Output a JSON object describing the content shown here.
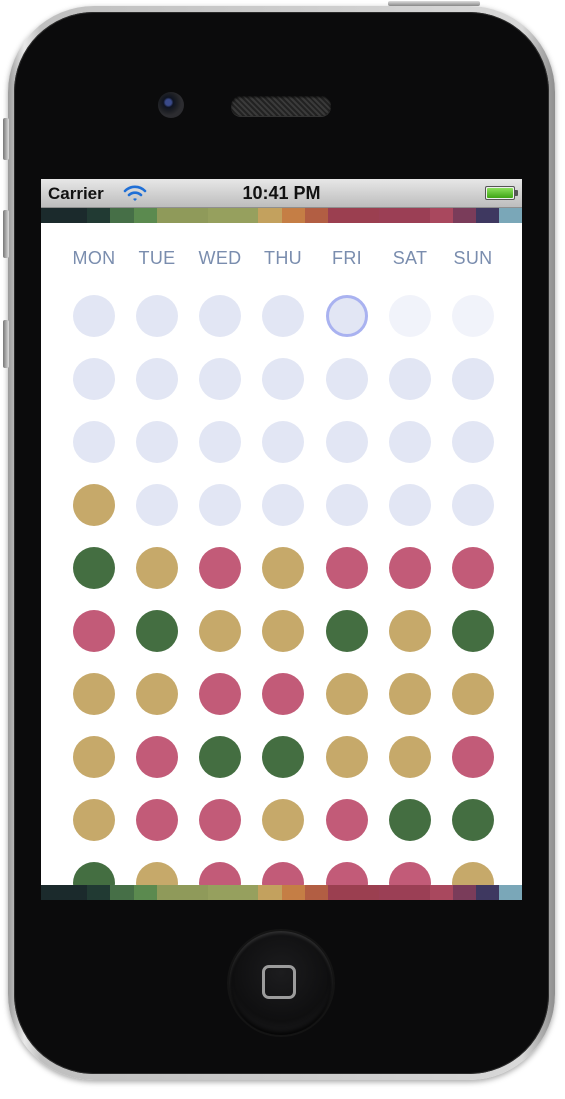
{
  "status_bar": {
    "carrier": "Carrier",
    "time": "10:41 PM",
    "battery_level": 1.0
  },
  "colors": {
    "empty": "#e2e6f4",
    "empty_future": "#f1f3fa",
    "gold": "#c6a96a",
    "green": "#446e41",
    "pink": "#c25b78",
    "today_ring": "#a9b2f0",
    "header_text": "#7a8dae"
  },
  "palette_strip": [
    "#1b2a2c",
    "#1b2a2c",
    "#213a33",
    "#466f47",
    "#5b8a4f",
    "#8f9a5a",
    "#96a05e",
    "#c3a15e",
    "#c57e45",
    "#b25e43",
    "#9b3f50",
    "#9b3f55",
    "#a9485e",
    "#7a3c5a",
    "#3e3860",
    "#7aa7b8"
  ],
  "days": [
    "MON",
    "TUE",
    "WED",
    "THU",
    "FRI",
    "SAT",
    "SUN"
  ],
  "today_index": 4,
  "grid": [
    [
      "empty",
      "empty",
      "empty",
      "empty",
      "today",
      "future",
      "future"
    ],
    [
      "empty",
      "empty",
      "empty",
      "empty",
      "empty",
      "empty",
      "empty"
    ],
    [
      "empty",
      "empty",
      "empty",
      "empty",
      "empty",
      "empty",
      "empty"
    ],
    [
      "gold",
      "empty",
      "empty",
      "empty",
      "empty",
      "empty",
      "empty"
    ],
    [
      "green",
      "gold",
      "pink",
      "gold",
      "pink",
      "pink",
      "pink"
    ],
    [
      "pink",
      "green",
      "gold",
      "gold",
      "green",
      "gold",
      "green"
    ],
    [
      "gold",
      "gold",
      "pink",
      "pink",
      "gold",
      "gold",
      "gold"
    ],
    [
      "gold",
      "pink",
      "green",
      "green",
      "gold",
      "gold",
      "pink"
    ],
    [
      "gold",
      "pink",
      "pink",
      "gold",
      "pink",
      "green",
      "green"
    ],
    [
      "green",
      "gold",
      "pink",
      "pink",
      "pink",
      "pink",
      "gold"
    ]
  ]
}
